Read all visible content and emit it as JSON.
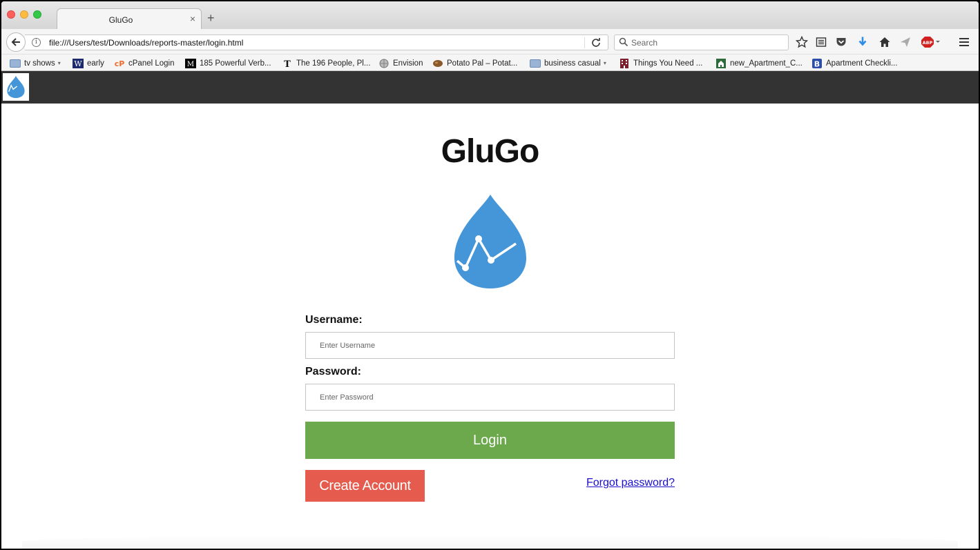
{
  "browser": {
    "tab_title": "GluGo",
    "tab_close": "×",
    "new_tab": "+",
    "url": "file:///Users/test/Downloads/reports-master/login.html",
    "search_placeholder": "Search"
  },
  "bookmarks": [
    {
      "label": "tv shows",
      "icon": "folder-icon",
      "caret": "▾"
    },
    {
      "label": "early",
      "icon": "w-icon"
    },
    {
      "label": "cPanel Login",
      "icon": "cpanel-icon"
    },
    {
      "label": "185 Powerful Verb...",
      "icon": "m-icon"
    },
    {
      "label": "The 196 People, Pl...",
      "icon": "nyt-icon"
    },
    {
      "label": "Envision",
      "icon": "globe-icon"
    },
    {
      "label": "Potato Pal – Potat...",
      "icon": "potato-icon"
    },
    {
      "label": "business casual",
      "icon": "folder-icon",
      "caret": "▾"
    },
    {
      "label": "Things You Need ...",
      "icon": "building-icon"
    },
    {
      "label": "new_Apartment_C...",
      "icon": "house-icon"
    },
    {
      "label": "Apartment Checkli...",
      "icon": "b-icon"
    }
  ],
  "app": {
    "title": "GluGo",
    "username_label": "Username:",
    "username_placeholder": "Enter Username",
    "password_label": "Password:",
    "password_placeholder": "Enter Password",
    "login_label": "Login",
    "create_account_label": "Create Account",
    "forgot_password_label": "Forgot password?"
  },
  "colors": {
    "header_bg": "#333333",
    "brand_blue": "#4596d8",
    "login_green": "#6ca84c",
    "create_red": "#e55b4d",
    "link_blue": "#1a0dcc"
  }
}
